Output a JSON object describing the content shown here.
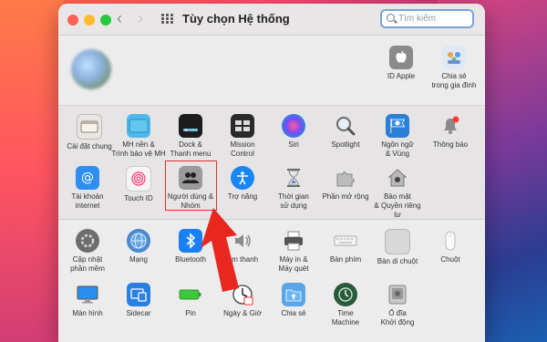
{
  "window": {
    "title": "Tùy chọn Hệ thống"
  },
  "search": {
    "placeholder": "Tìm kiếm"
  },
  "profile": {
    "apple_id": {
      "label": "ID Apple",
      "icon": "apple-icon"
    },
    "family": {
      "label": "Chia sẻ\ntrong gia đình",
      "icon": "family-sharing-icon"
    }
  },
  "row1": [
    {
      "label": "Cài đặt chung",
      "icon": "general-icon"
    },
    {
      "label": "MH nền &\nTrình bảo vệ MH",
      "icon": "desktop-screensaver-icon"
    },
    {
      "label": "Dock &\nThanh menu",
      "icon": "dock-icon"
    },
    {
      "label": "Mission\nControl",
      "icon": "mission-control-icon"
    },
    {
      "label": "Siri",
      "icon": "siri-icon"
    },
    {
      "label": "Spotlight",
      "icon": "spotlight-icon"
    },
    {
      "label": "Ngôn ngữ\n& Vùng",
      "icon": "language-region-icon"
    },
    {
      "label": "Thông báo",
      "icon": "notifications-icon"
    }
  ],
  "row2": [
    {
      "label": "Tài khoản\ninternet",
      "icon": "internet-accounts-icon"
    },
    {
      "label": "Touch ID",
      "icon": "touch-id-icon"
    },
    {
      "label": "Người dùng &\nNhóm",
      "icon": "users-groups-icon"
    },
    {
      "label": "Trợ năng",
      "icon": "accessibility-icon"
    },
    {
      "label": "Thời gian\nsử dụng",
      "icon": "screen-time-icon"
    },
    {
      "label": "Phần mở rộng",
      "icon": "extensions-icon"
    },
    {
      "label": "Bảo mật\n& Quyền riêng tư",
      "icon": "security-privacy-icon"
    }
  ],
  "row3": [
    {
      "label": "Cập nhật\nphần mềm",
      "icon": "software-update-icon"
    },
    {
      "label": "Mạng",
      "icon": "network-icon"
    },
    {
      "label": "Bluetooth",
      "icon": "bluetooth-icon"
    },
    {
      "label": "Âm thanh",
      "icon": "sound-icon"
    },
    {
      "label": "Máy in &\nMáy quét",
      "icon": "printers-scanners-icon"
    },
    {
      "label": "Bàn phím",
      "icon": "keyboard-icon"
    },
    {
      "label": "Bàn di chuột",
      "icon": "trackpad-icon"
    },
    {
      "label": "Chuột",
      "icon": "mouse-icon"
    }
  ],
  "row4": [
    {
      "label": "Màn hình",
      "icon": "displays-icon"
    },
    {
      "label": "Sidecar",
      "icon": "sidecar-icon"
    },
    {
      "label": "Pin",
      "icon": "battery-icon"
    },
    {
      "label": "Ngày & Giờ",
      "icon": "date-time-icon"
    },
    {
      "label": "Chia sẻ",
      "icon": "sharing-icon"
    },
    {
      "label": "Time\nMachine",
      "icon": "time-machine-icon"
    },
    {
      "label": "Ổ đĩa\nKhởi động",
      "icon": "startup-disk-icon"
    }
  ],
  "colors": {
    "highlight": "#e03030",
    "arrow": "#e8271f"
  }
}
